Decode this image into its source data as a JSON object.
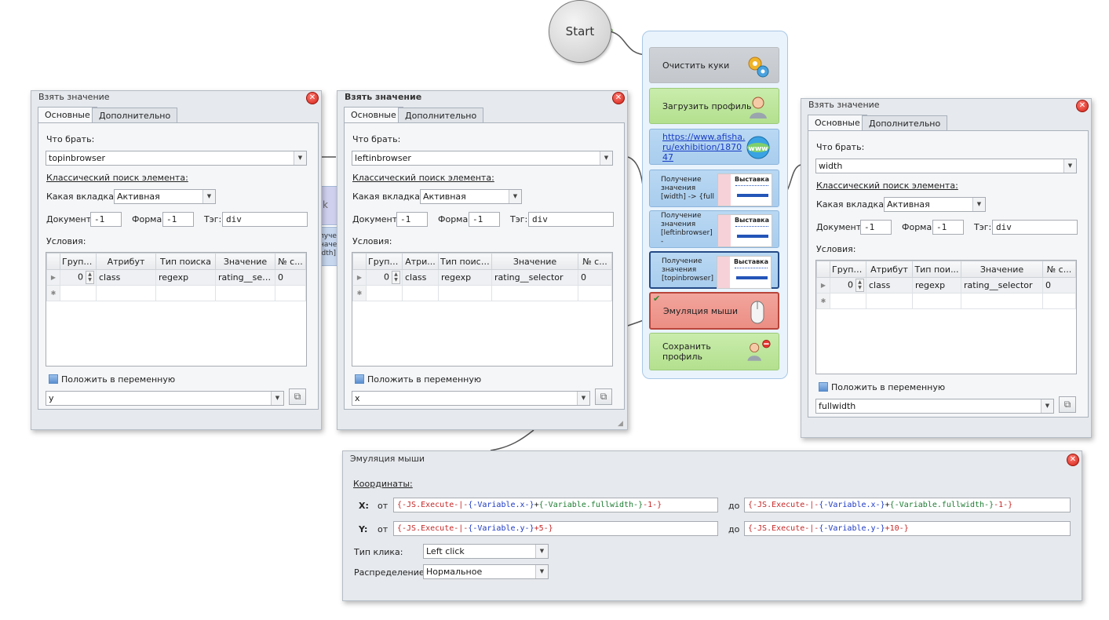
{
  "start_label": "Start",
  "blocks": [
    {
      "label": "Очистить куки",
      "icon": "gears-icon"
    },
    {
      "label": "Загрузить профиль",
      "icon": "user-icon"
    },
    {
      "label": "https://www.afisha.ru/exhibition/187047",
      "icon": "www-globe-icon"
    },
    {
      "label": "Получение значения [width] -> {full",
      "thumb": "Выставка"
    },
    {
      "label": "Получение значения [leftinbrowser] -",
      "thumb": "Выставка"
    },
    {
      "label": "Получение значения [topinbrowser]",
      "thumb": "Выставка"
    },
    {
      "label": "Эмуляция мыши",
      "icon": "mouse-icon"
    },
    {
      "label": "Сохранить профиль",
      "icon": "user-save-icon"
    }
  ],
  "ghost_text": "k",
  "ghost_lines": [
    "луче",
    "начен",
    "idth]"
  ],
  "common": {
    "tab_main": "Основные",
    "tab_extra": "Дополнительно",
    "what_label": "Что брать:",
    "classic_search": "Классический поиск элемента:",
    "tab_which": "Какая вкладка:",
    "tab_value": "Активная",
    "doc_label": "Документ:",
    "doc_value": "-1",
    "form_label": "Форма:",
    "form_value": "-1",
    "tag_label": "Тэг:",
    "tag_value": "div",
    "conditions": "Условия:",
    "put_var": "Положить в переменную"
  },
  "windows": [
    {
      "title": "Взять значение",
      "what": "topinbrowser",
      "headers": [
        "Группа",
        "Атрибут",
        "Тип поиска",
        "Значение",
        "№ с..."
      ],
      "row": {
        "group": "0",
        "attr": "class",
        "type": "regexp",
        "value": "rating__sel...",
        "num": "0"
      },
      "variable": "y"
    },
    {
      "title": "Взять значение",
      "what": "leftinbrowser",
      "headers": [
        "Группа",
        "Атри...",
        "Тип поиска",
        "Значение",
        "№ с..."
      ],
      "row": {
        "group": "0",
        "attr": "class",
        "type": "regexp",
        "value": "rating__selector",
        "num": "0"
      },
      "variable": "x"
    },
    {
      "title": "Взять значение",
      "what": "width",
      "headers": [
        "Группа",
        "Атрибут",
        "Тип пои...",
        "Значение",
        "№ с..."
      ],
      "row": {
        "group": "0",
        "attr": "class",
        "type": "regexp",
        "value": "rating__selector",
        "num": "0"
      },
      "variable": "fullwidth"
    }
  ],
  "mouse": {
    "title": "Эмуляция мыши",
    "coords": "Координаты:",
    "x_label": "X:",
    "y_label": "Y:",
    "from": "от",
    "to": "до",
    "x_from": [
      "{-JS.Execute-|-",
      "{-Variable.x-}",
      "+",
      "{-Variable.fullwidth-}",
      "-1-}"
    ],
    "x_to": [
      "{-JS.Execute-|-",
      "{-Variable.x-}",
      "+",
      "{-Variable.fullwidth-}",
      "-1-}"
    ],
    "y_from": [
      "{-JS.Execute-|-",
      "{-Variable.y-}",
      "+5-}"
    ],
    "y_to": [
      "{-JS.Execute-|-",
      "{-Variable.y-}",
      "+10-}"
    ],
    "click_label": "Тип клика:",
    "click_value": "Left click",
    "dist_label": "Распределение:",
    "dist_value": "Нормальное"
  },
  "colors": {
    "red": "#c62828",
    "blue": "#1d39c4",
    "green": "#1e7d32"
  }
}
